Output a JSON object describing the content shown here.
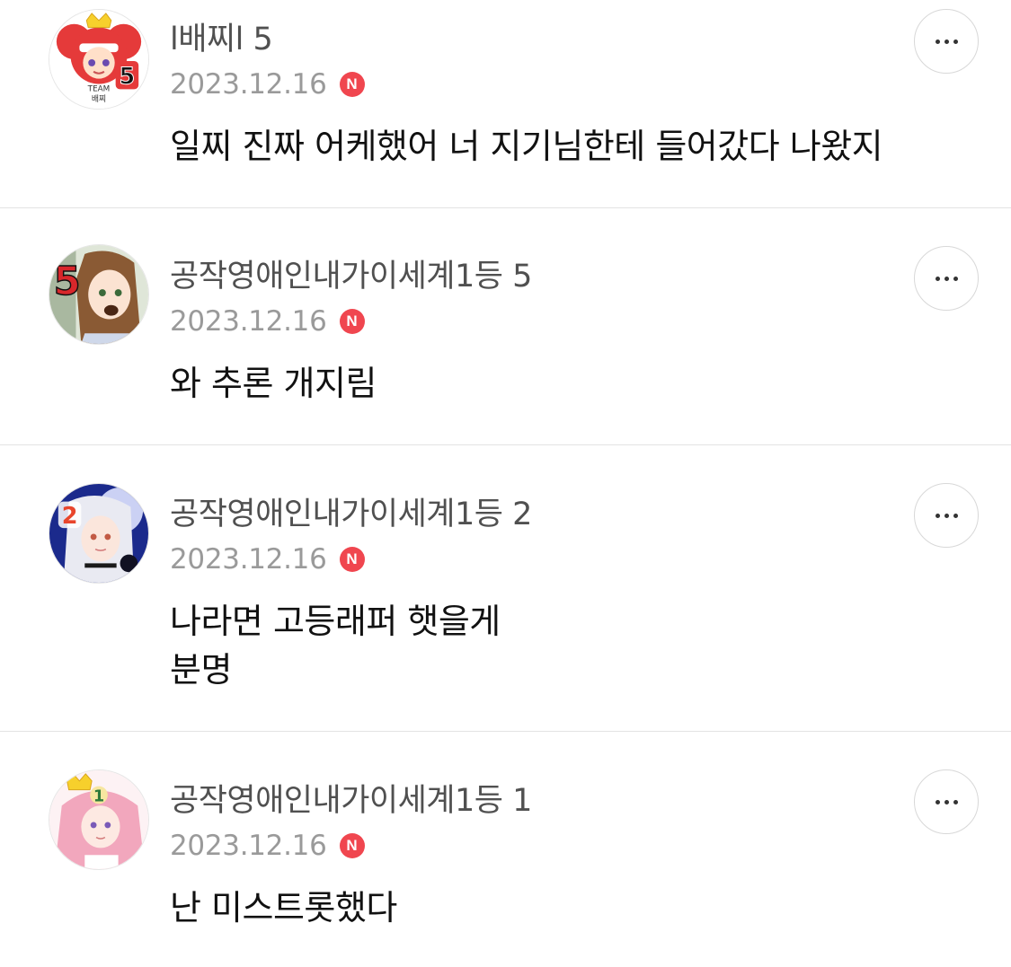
{
  "comments": [
    {
      "nickname": "l배찌l 5",
      "date": "2023.12.16",
      "badge": "N",
      "lines": [
        "일찌 진짜 어케했어 너 지기님한테 들어갔다 나왔지"
      ],
      "avatar_icon": "team-baejji-logo-avatar",
      "avatar_text_top": "TEAM",
      "avatar_text_bottom": "배찌",
      "avatar_number": "5"
    },
    {
      "nickname": "공작영애인내가이세계1등 5",
      "date": "2023.12.16",
      "badge": "N",
      "lines": [
        "와 추론 개지림"
      ],
      "avatar_icon": "brown-hair-girl-avatar",
      "avatar_number": "5"
    },
    {
      "nickname": "공작영애인내가이세계1등 2",
      "date": "2023.12.16",
      "badge": "N",
      "lines": [
        "나라면 고등래퍼 햇을게",
        "분명"
      ],
      "avatar_icon": "silver-hair-girl-avatar",
      "avatar_number": "2"
    },
    {
      "nickname": "공작영애인내가이세계1등 1",
      "date": "2023.12.16",
      "badge": "N",
      "lines": [
        "난 미스트롯했다"
      ],
      "avatar_icon": "pink-hair-girl-avatar",
      "avatar_number": "1"
    }
  ],
  "colors": {
    "badge_red": "#f0464f",
    "nickname": "#505050",
    "date": "#9a9a9a",
    "divider": "#e3e3e3"
  }
}
